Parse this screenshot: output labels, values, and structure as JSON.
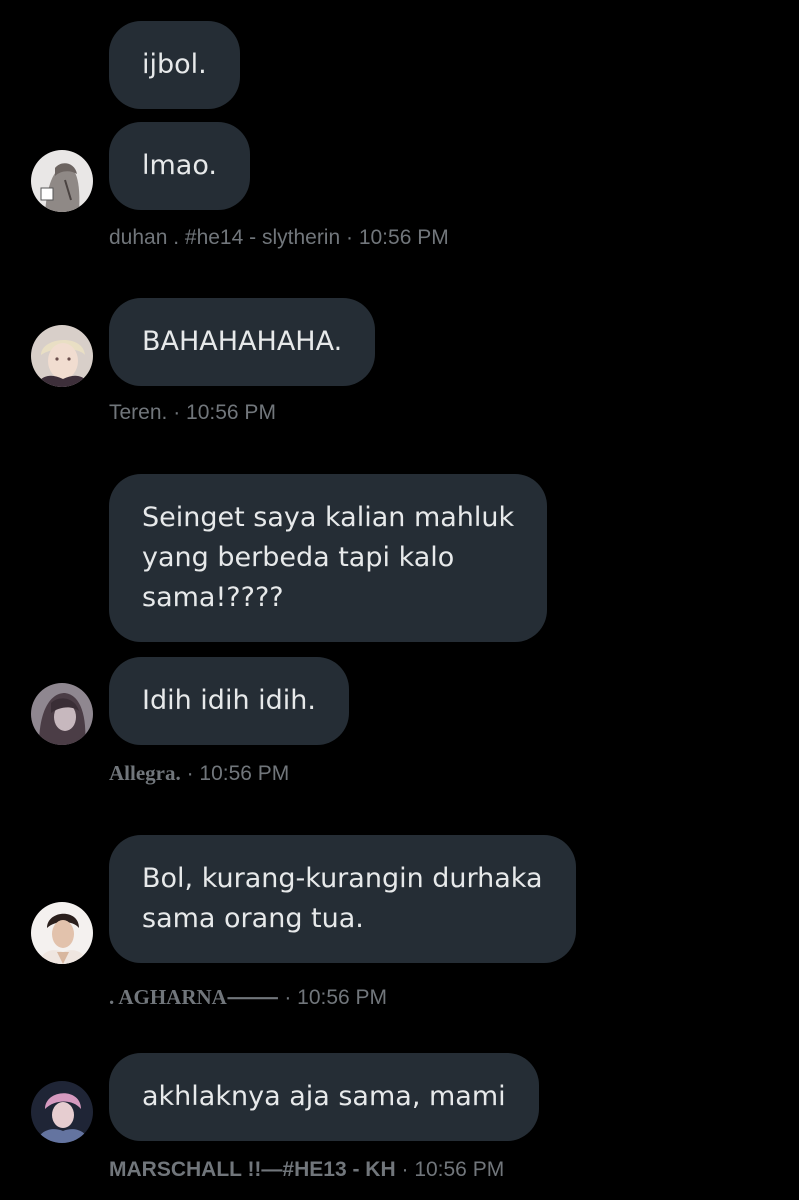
{
  "messages": [
    {
      "text": "ijbol."
    },
    {
      "text": "lmao."
    },
    {
      "text": "BAHAHAHAHA."
    },
    {
      "text_lines": [
        "Seinget saya kalian mahluk",
        "yang berbeda tapi kalo",
        "sama!????"
      ]
    },
    {
      "text": "Idih idih idih."
    },
    {
      "text_lines": [
        "Bol, kurang-kurangin durhaka",
        "sama orang tua."
      ]
    },
    {
      "text": "akhlaknya aja sama, mami"
    }
  ],
  "meta": [
    {
      "sender": "duhan . #he14 - slytherin",
      "time": "10:56 PM"
    },
    {
      "sender": "Teren.",
      "time": "10:56 PM"
    },
    {
      "sender": "Allegra.",
      "time": "10:56 PM"
    },
    {
      "sender": ". AGHARNA⸻",
      "time": "10:56 PM"
    },
    {
      "sender": "MARSCHALL !!—#HE13 - KH",
      "time": "10:56 PM"
    }
  ],
  "separator": " · ",
  "colors": {
    "background": "#000000",
    "bubble": "#252d35",
    "text": "#e7e9ea",
    "meta": "#71767b"
  }
}
